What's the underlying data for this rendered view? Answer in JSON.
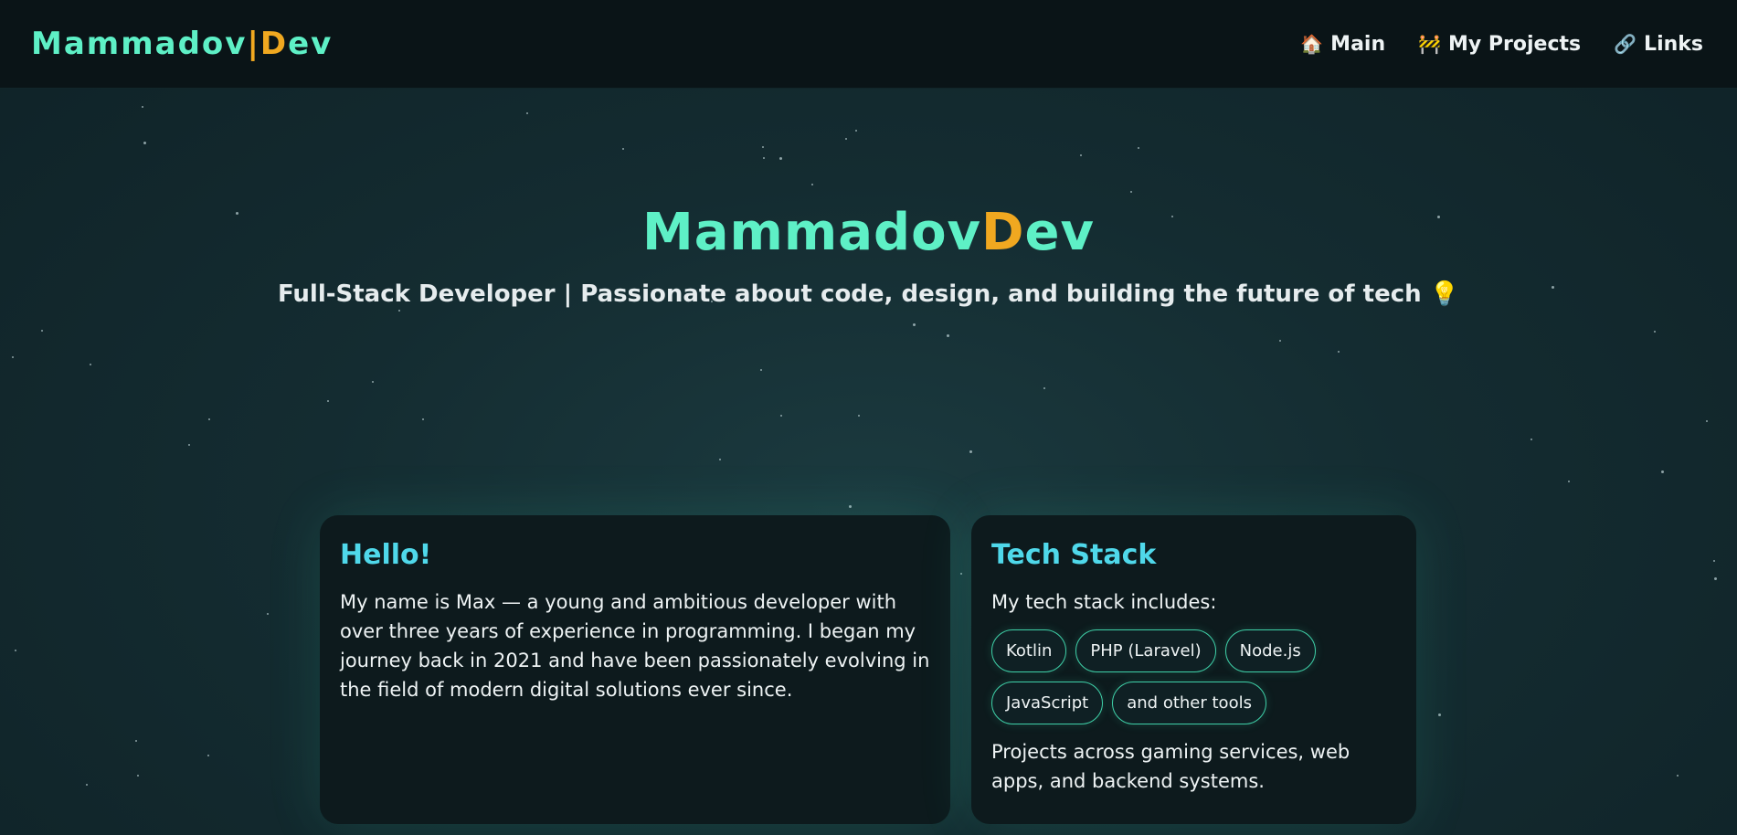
{
  "header": {
    "logo": {
      "part1": "Mammadov",
      "separator": "|",
      "part2_accent": "D",
      "part2_rest": "ev"
    },
    "nav": [
      {
        "icon": "🏠",
        "label": "Main"
      },
      {
        "icon": "🚧",
        "label": "My Projects"
      },
      {
        "icon": "🔗",
        "label": "Links"
      }
    ]
  },
  "hero": {
    "title_part1": "Mammadov",
    "title_accent": "D",
    "title_rest": "ev",
    "subtitle": "Full-Stack Developer | Passionate about code, design, and building the future of tech 💡"
  },
  "cards": {
    "hello": {
      "title": "Hello!",
      "text": "My name is Max — a young and ambitious developer with over three years of experience in programming. I began my journey back in 2021 and have been passionately evolving in the field of modern digital solutions ever since."
    },
    "tech": {
      "title": "Tech Stack",
      "intro": "My tech stack includes:",
      "chips": [
        "Kotlin",
        "PHP (Laravel)",
        "Node.js",
        "JavaScript",
        "and other tools"
      ],
      "outro": "Projects across gaming services, web apps, and backend systems."
    }
  },
  "colors": {
    "brand": "#5ef0c6",
    "accent": "#f0a820",
    "card_title": "#4fd8ea",
    "card_bg": "#0d1a1d",
    "header_bg": "#0a1417"
  }
}
